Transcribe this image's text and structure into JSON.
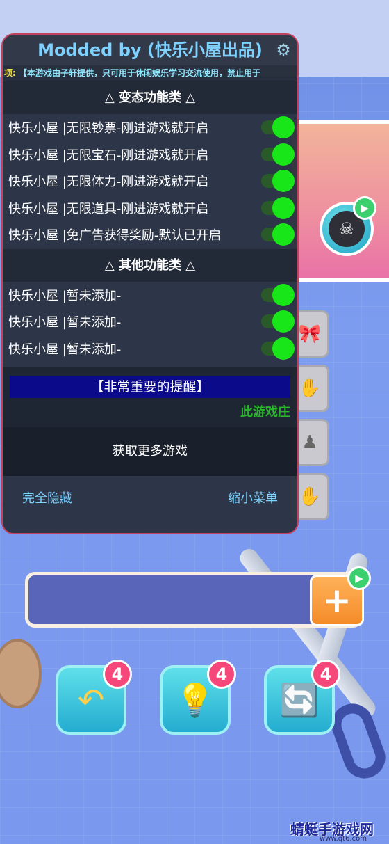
{
  "mod_menu": {
    "title": "Modded by (快乐小屋出品)",
    "ticker_lead": "项:",
    "ticker_text": "【本游戏由子轩提供，只可用于休闲娱乐学习交流使用，禁止用于",
    "sections": [
      {
        "heading": "△ 变态功能类 △",
        "items": [
          {
            "label": "快乐小屋 |无限钞票-刚进游戏就开启",
            "enabled": true
          },
          {
            "label": "快乐小屋 |无限宝石-刚进游戏就开启",
            "enabled": true
          },
          {
            "label": "快乐小屋 |无限体力-刚进游戏就开启",
            "enabled": true
          },
          {
            "label": "快乐小屋 |无限道具-刚进游戏就开启",
            "enabled": true
          },
          {
            "label": "快乐小屋 |免广告获得奖励-默认已开启",
            "enabled": true
          }
        ]
      },
      {
        "heading": "△ 其他功能类 △",
        "items": [
          {
            "label": "快乐小屋 |暂未添加-",
            "enabled": true
          },
          {
            "label": "快乐小屋 |暂未添加-",
            "enabled": true
          },
          {
            "label": "快乐小屋 |暂未添加-",
            "enabled": true
          }
        ]
      }
    ],
    "reminder": "【非常重要的提醒】",
    "notice": "此游戏庄",
    "more_games": "获取更多游戏",
    "hide_all": "完全隐藏",
    "minimize": "缩小菜单"
  },
  "game": {
    "power_ups": [
      {
        "name": "undo",
        "count": "4",
        "icon": "↶"
      },
      {
        "name": "hint",
        "count": "4",
        "icon": "💡"
      },
      {
        "name": "shuffle",
        "count": "4",
        "icon": "🔄"
      }
    ],
    "add_slot_icon": "+",
    "bomb_icon": "☠"
  },
  "watermark": {
    "text": "蜻蜓手游戏网",
    "url": "www.qt6.com"
  },
  "colors": {
    "background": "#7a98ee",
    "panel_border": "#c2415c",
    "title": "#7fd2ff",
    "toggle_on": "#19e619",
    "reminder_bg": "#0a0a8a"
  }
}
